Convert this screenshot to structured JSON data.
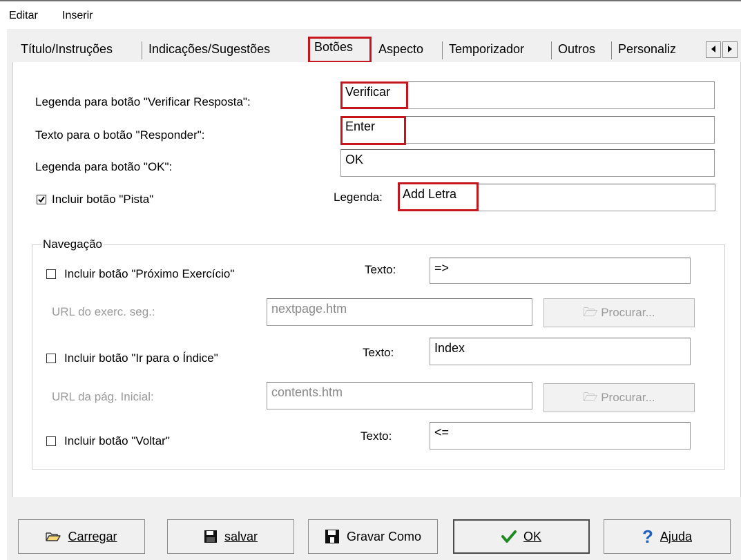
{
  "menu": {
    "items": [
      "Editar",
      "Inserir"
    ]
  },
  "tabs": {
    "items": [
      "Título/Instruções",
      "Indicações/Sugestões",
      "Botões",
      "Aspecto",
      "Temporizador",
      "Outros",
      "Personaliz"
    ],
    "active": "Botões"
  },
  "fields": {
    "verificar_label": "Legenda para botão \"Verificar Resposta\":",
    "verificar_value": "Verificar",
    "responder_label": "Texto para o botão \"Responder\":",
    "responder_value": "Enter",
    "ok_label": "Legenda para botão \"OK\":",
    "ok_value": "OK",
    "pista_checkbox_label": "Incluir botão \"Pista\"",
    "pista_checked": true,
    "legenda_label": "Legenda:",
    "legenda_value": "Add Letra"
  },
  "navigation": {
    "group_title": "Navegação",
    "proximo_label": "Incluir botão \"Próximo Exercício\"",
    "proximo_texto_label": "Texto:",
    "proximo_texto_value": "=>",
    "url_exerc_label": "URL do exerc. seg.:",
    "url_exerc_value": "nextpage.htm",
    "procurar_label": "Procurar...",
    "indice_label": "Incluir botão \"Ir para o Índice\"",
    "indice_texto_label": "Texto:",
    "indice_texto_value": "Index",
    "url_pag_label": "URL da pág. Inicial:",
    "url_pag_value": "contents.htm",
    "voltar_label": "Incluir botão \"Voltar\"",
    "voltar_texto_label": "Texto:",
    "voltar_texto_value": "<="
  },
  "footer": {
    "carregar": "Carregar",
    "salvar": "salvar",
    "gravar_como": "Gravar Como",
    "ok": "OK",
    "ajuda": "Ajuda"
  },
  "colors": {
    "highlight": "#c4161c",
    "ok_check": "#1f8a1f",
    "help": "#1f5fbf"
  }
}
